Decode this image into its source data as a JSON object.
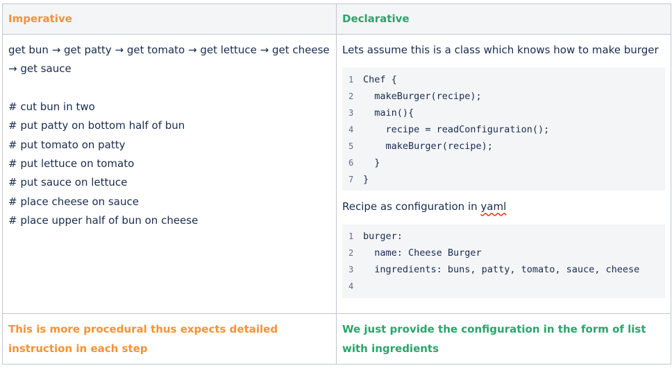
{
  "table": {
    "headers": {
      "imperative": "Imperative",
      "declarative": "Declarative"
    },
    "imperative": {
      "steps_text": "get bun → get patty → get tomato → get lettuce → get cheese → get sauce",
      "comments": [
        "# cut bun in two",
        "# put patty on bottom half of bun",
        "# put tomato on patty",
        "# put lettuce on tomato",
        "# put sauce on lettuce",
        "# place cheese on sauce",
        "# place upper half of bun on cheese"
      ]
    },
    "declarative": {
      "intro": "Lets assume this is a class which knows how to make burger",
      "chef_code": [
        {
          "n": "1",
          "code": "Chef {"
        },
        {
          "n": "2",
          "code": "  makeBurger(recipe);"
        },
        {
          "n": "3",
          "code": "  main(){"
        },
        {
          "n": "4",
          "code": "    recipe = readConfiguration();"
        },
        {
          "n": "5",
          "code": "    makeBurger(recipe);"
        },
        {
          "n": "6",
          "code": "  }"
        },
        {
          "n": "7",
          "code": "}"
        }
      ],
      "recipe_label_prefix": "Recipe as configuration in ",
      "recipe_label_word": "yaml",
      "yaml_code": [
        {
          "n": "1",
          "code": "burger:"
        },
        {
          "n": "2",
          "code": "  name: Cheese Burger"
        },
        {
          "n": "3",
          "code": "  ingredients: buns, patty, tomato, sauce, cheese"
        },
        {
          "n": "4",
          "code": ""
        }
      ]
    },
    "footers": {
      "imperative": "This is more procedural thus expects detailed instruction in each step",
      "declarative": "We just provide the configuration in the form of list with ingredients"
    }
  },
  "colors": {
    "imperative_accent": "#f79232",
    "declarative_accent": "#2aa56b",
    "border": "#c1c7d0",
    "code_background": "#f4f5f7"
  }
}
